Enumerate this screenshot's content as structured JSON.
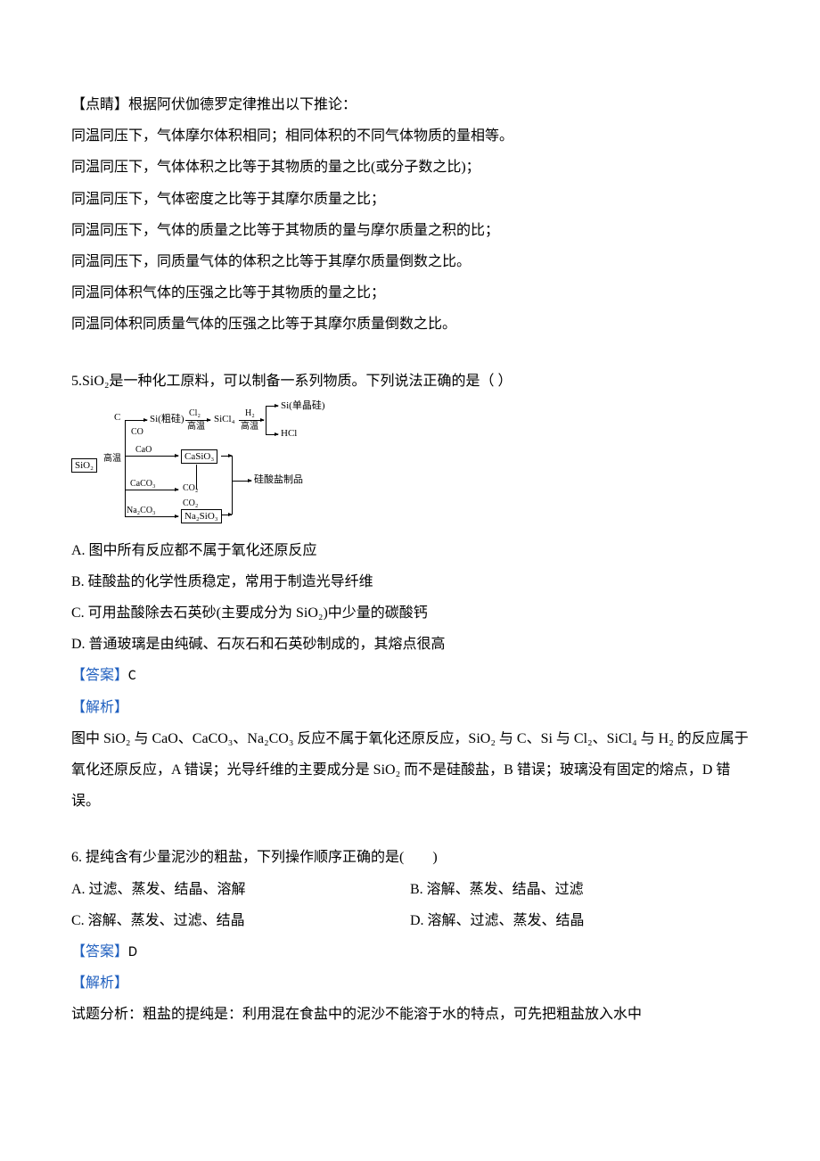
{
  "tip": {
    "heading": "【点睛】根据阿伏伽德罗定律推出以下推论：",
    "lines": [
      "同温同压下，气体摩尔体积相同；相同体积的不同气体物质的量相等。",
      "同温同压下，气体体积之比等于其物质的量之比(或分子数之比)；",
      "同温同压下，气体密度之比等于其摩尔质量之比；",
      "同温同压下，气体的质量之比等于其物质的量与摩尔质量之积的比；",
      "同温同压下，同质量气体的体积之比等于其摩尔质量倒数之比。",
      "同温同体积气体的压强之比等于其物质的量之比；",
      "同温同体积同质量气体的压强之比等于其摩尔质量倒数之比。"
    ]
  },
  "q5": {
    "stem": "5.SiO₂是一种化工原料，可以制备一系列物质。下列说法正确的是（ ）",
    "diagram": {
      "sio2": "SiO₂",
      "hi_temp": "高温",
      "c": "C",
      "co": "CO",
      "cao": "CaO",
      "caco3": "CaCO₃",
      "na2co3": "Na₂CO₃",
      "si_crude": "Si(粗硅)",
      "cl2": "Cl₂",
      "sicl4": "SiCl₄",
      "h2": "H₂",
      "si_pure": "Si(单晶硅)",
      "hcl": "HCl",
      "casio3": "CaSiO₃",
      "co2": "CO₂",
      "na2sio3": "Na₂SiO₃",
      "silicate": "硅酸盐制品"
    },
    "options": {
      "A": "A.  图中所有反应都不属于氧化还原反应",
      "B": "B.  硅酸盐的化学性质稳定，常用于制造光导纤维",
      "C": "C.  可用盐酸除去石英砂(主要成分为 SiO₂)中少量的碳酸钙",
      "D": "D.  普通玻璃是由纯碱、石灰石和石英砂制成的，其熔点很高"
    },
    "answer_label": "【答案】",
    "answer": "C",
    "analysis_label": "【解析】",
    "analysis": "图中 SiO₂ 与 CaO、CaCO₃、Na₂CO₃ 反应不属于氧化还原反应，SiO₂ 与 C、Si 与 Cl₂、SiCl₄ 与 H₂ 的反应属于氧化还原反应，A 错误；光导纤维的主要成分是 SiO₂ 而不是硅酸盐，B 错误；玻璃没有固定的熔点，D 错误。"
  },
  "q6": {
    "stem": "6.  提纯含有少量泥沙的粗盐，下列操作顺序正确的是(　　)",
    "options": {
      "A": "A.  过滤、蒸发、结晶、溶解",
      "B": "B.  溶解、蒸发、结晶、过滤",
      "C": "C.  溶解、蒸发、过滤、结晶",
      "D": "D.  溶解、过滤、蒸发、结晶"
    },
    "answer_label": "【答案】",
    "answer": "D",
    "analysis_label": "【解析】",
    "analysis": "试题分析：粗盐的提纯是：利用混在食盐中的泥沙不能溶于水的特点，可先把粗盐放入水中"
  }
}
